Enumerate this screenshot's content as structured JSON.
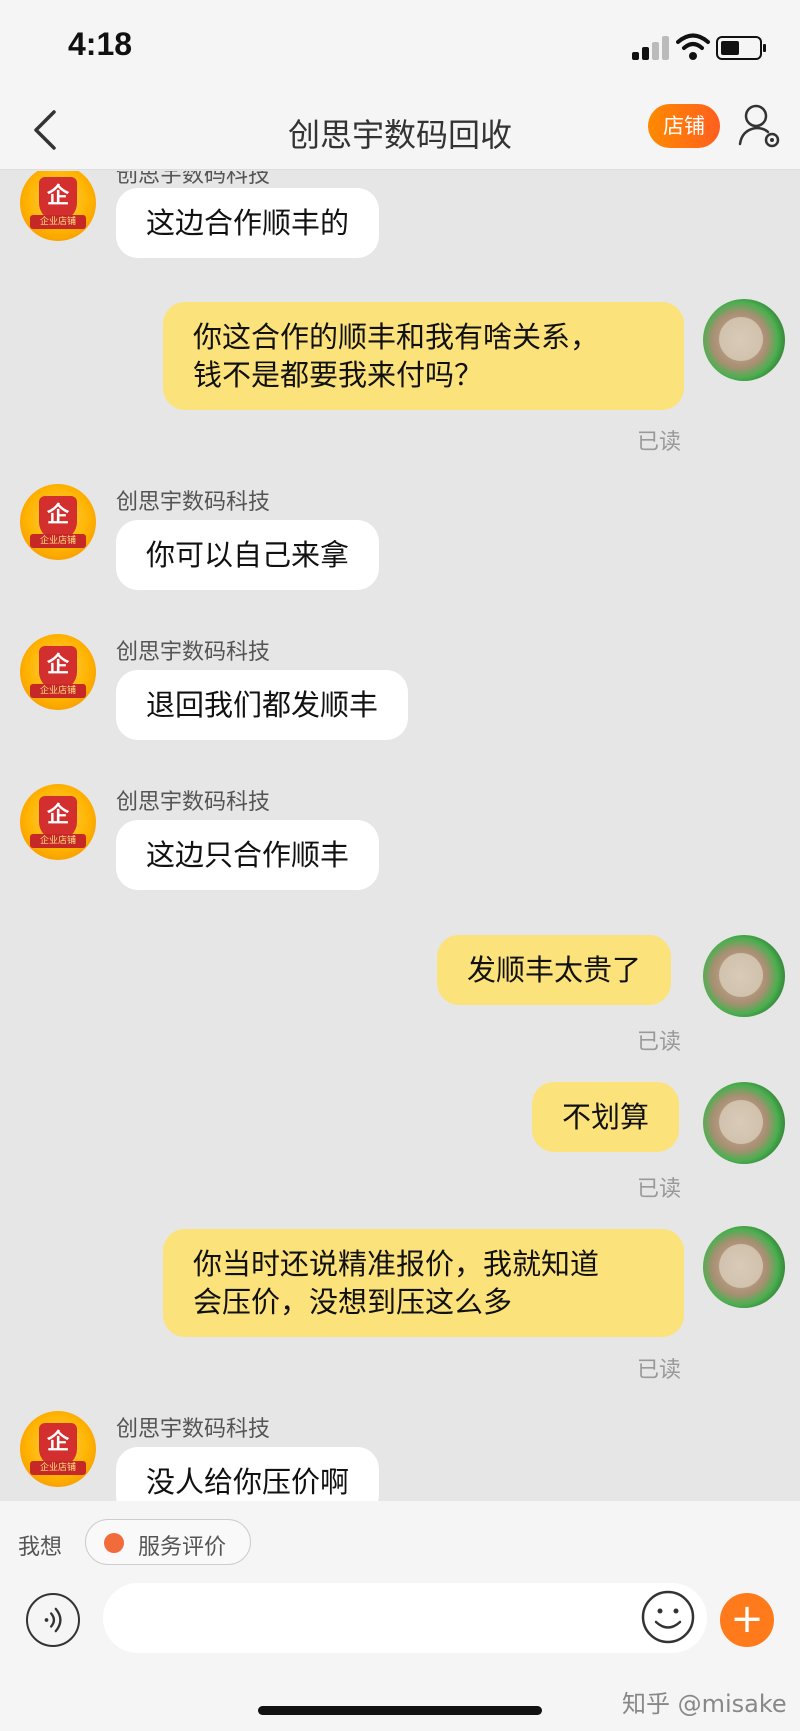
{
  "status_bar": {
    "time": "4:18"
  },
  "nav": {
    "title": "创思宇数码回收",
    "shop_label": "店铺"
  },
  "shop": {
    "name": "创思宇数码科技",
    "badge_char": "企",
    "badge_ribbon": "企业店铺"
  },
  "messages": [
    {
      "side": "in",
      "text": "这边合作顺丰的"
    },
    {
      "side": "out",
      "lines": [
        "你这合作的顺丰和我有啥关系，",
        "钱不是都要我来付吗？"
      ],
      "status": "已读"
    },
    {
      "side": "in",
      "text": "你可以自己来拿"
    },
    {
      "side": "in",
      "text": "退回我们都发顺丰"
    },
    {
      "side": "in",
      "text": "这边只合作顺丰"
    },
    {
      "side": "out",
      "text": "发顺丰太贵了",
      "status": "已读"
    },
    {
      "side": "out",
      "text": "不划算",
      "status": "已读"
    },
    {
      "side": "out",
      "lines": [
        "你当时还说精准报价，我就知道",
        "会压价，没想到压这么多"
      ],
      "status": "已读"
    },
    {
      "side": "in",
      "text": "没人给你压价啊"
    }
  ],
  "bottom": {
    "wish_label": "我想",
    "rating_label": "服务评价",
    "input_placeholder": "",
    "watermark": "知乎 @misake"
  },
  "colors": {
    "accent": "#ff7a1a",
    "out_bubble": "#fbe27a",
    "in_bubble": "#ffffff",
    "background": "#e6e6e6"
  },
  "icons": [
    "back-icon",
    "user-settings-icon",
    "voice-icon",
    "emoji-icon",
    "plus-icon"
  ]
}
